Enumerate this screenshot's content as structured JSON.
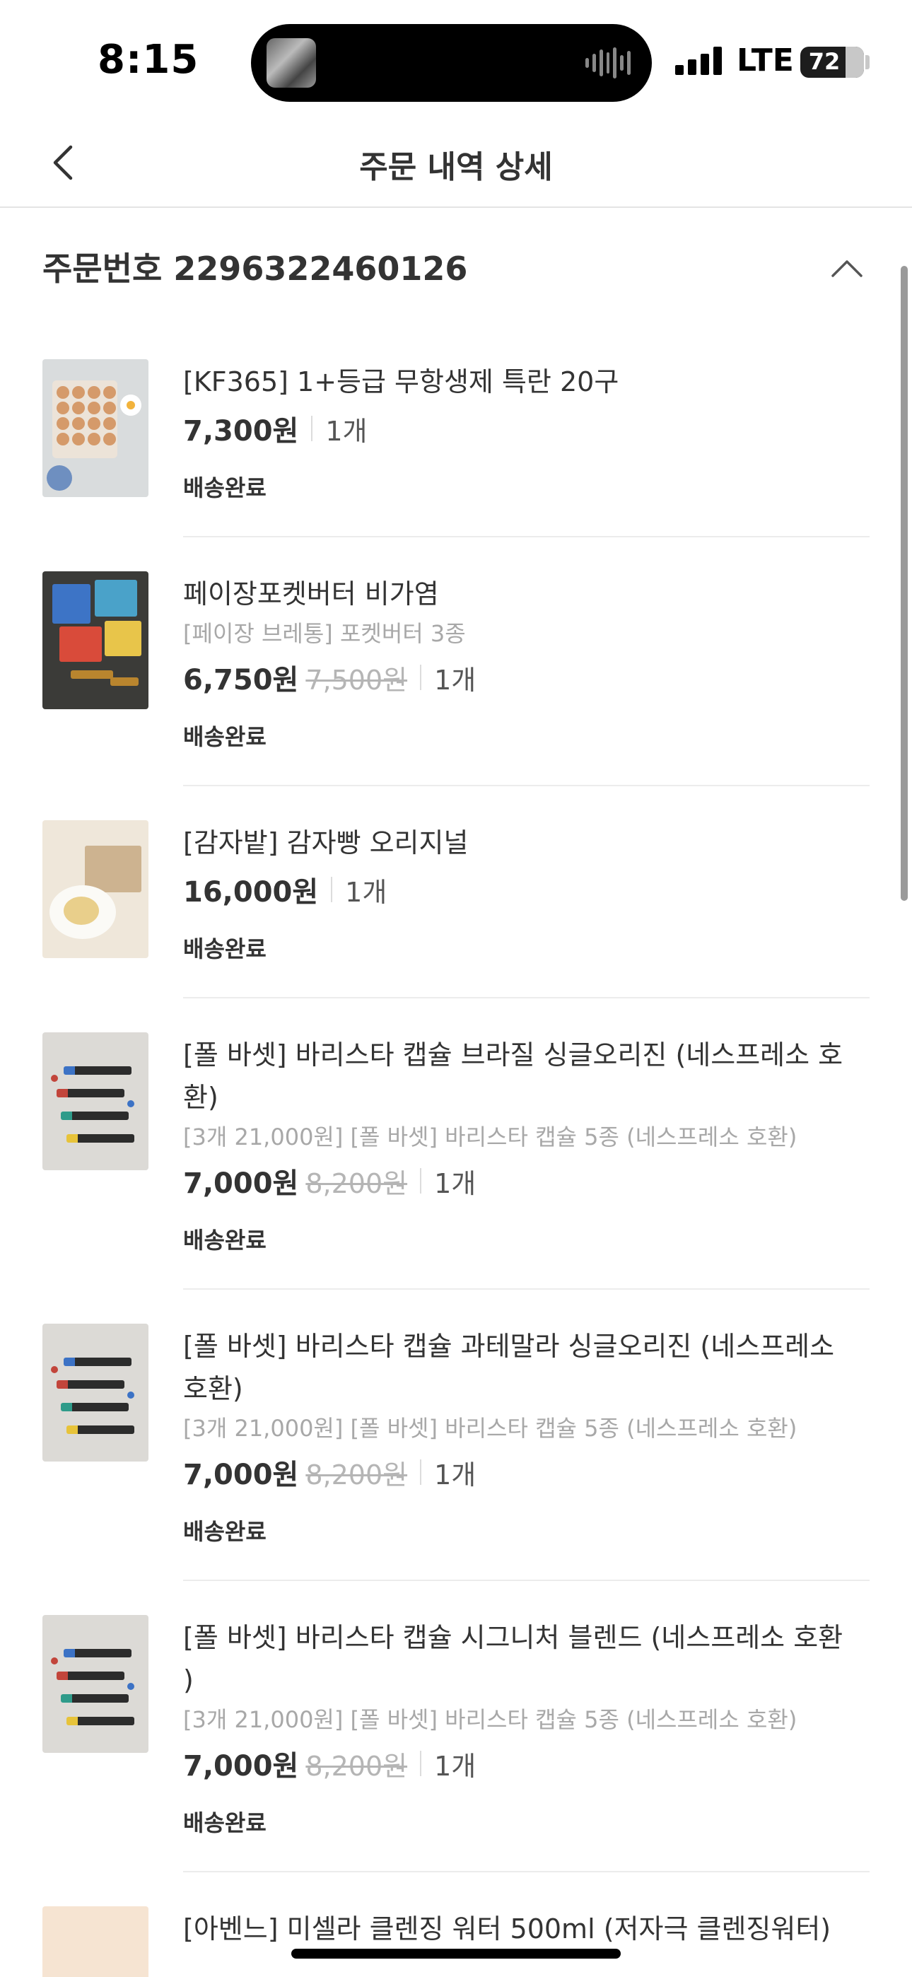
{
  "status_bar": {
    "time": "8:15",
    "network": "LTE",
    "battery": "72"
  },
  "nav": {
    "back_icon": "chevron-left-icon",
    "title": "주문 내역 상세"
  },
  "order": {
    "number_label": "주문번호 2296322460126",
    "collapse_icon": "chevron-up-icon"
  },
  "items": [
    {
      "name": "[KF365] 1+등급 무항생제 특란 20구",
      "option": "",
      "price": "7,300원",
      "original_price": "",
      "quantity": "1개",
      "status": "배송완료"
    },
    {
      "name": "페이장포켓버터 비가염",
      "option": "[페이장 브레통] 포켓버터 3종",
      "price": "6,750원",
      "original_price": "7,500원",
      "quantity": "1개",
      "status": "배송완료"
    },
    {
      "name": "[감자밭] 감자빵 오리지널",
      "option": "",
      "price": "16,000원",
      "original_price": "",
      "quantity": "1개",
      "status": "배송완료"
    },
    {
      "name_line1": "[폴 바셋] 바리스타 캡슐 브라질 싱글오리진 (네스프레소 호",
      "name_line2": "환)",
      "option": "[3개 21,000원] [폴 바셋] 바리스타 캡슐 5종 (네스프레소 호환)",
      "price": "7,000원",
      "original_price": "8,200원",
      "quantity": "1개",
      "status": "배송완료"
    },
    {
      "name_line1": "[폴 바셋] 바리스타 캡슐 과테말라 싱글오리진 (네스프레소",
      "name_line2": "호환)",
      "option": "[3개 21,000원] [폴 바셋] 바리스타 캡슐 5종 (네스프레소 호환)",
      "price": "7,000원",
      "original_price": "8,200원",
      "quantity": "1개",
      "status": "배송완료"
    },
    {
      "name_line1": "[폴 바셋] 바리스타 캡슐 시그니처 블렌드 (네스프레소 호환",
      "name_line2": ")",
      "option": "[3개 21,000원] [폴 바셋] 바리스타 캡슐 5종 (네스프레소 호환)",
      "price": "7,000원",
      "original_price": "8,200원",
      "quantity": "1개",
      "status": "배송완료"
    },
    {
      "name": "[아벤느] 미셀라 클렌징 워터 500ml (저자극 클렌징워터)"
    }
  ]
}
